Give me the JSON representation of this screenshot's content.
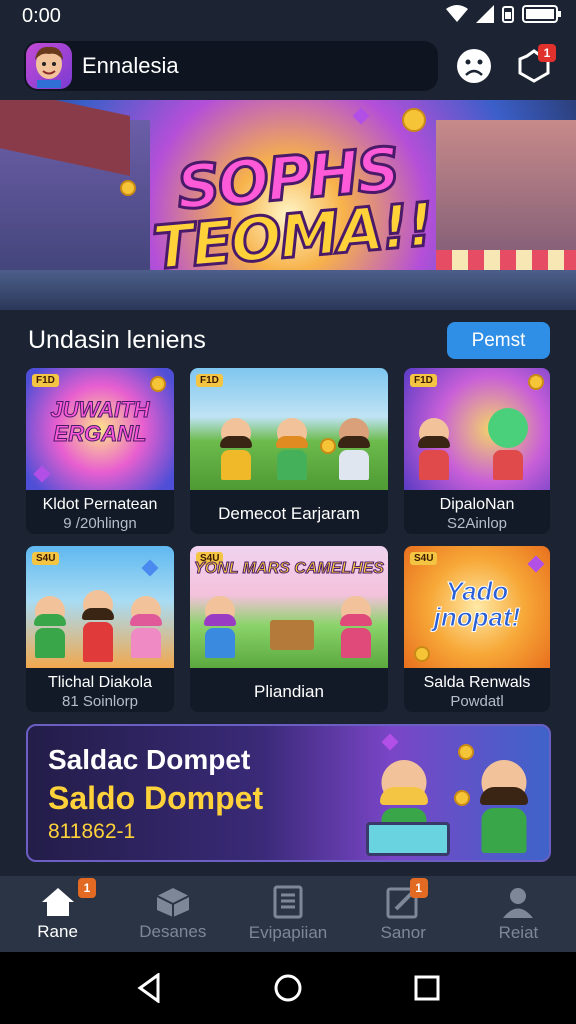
{
  "status_bar": {
    "time": "0:00"
  },
  "header": {
    "username": "Ennalesia",
    "notification_count": "1"
  },
  "hero": {
    "title_line1": "SOPHS",
    "title_line2": "TEOMA!!"
  },
  "section": {
    "title": "Undasin leniens",
    "button_label": "Pemst"
  },
  "cards": [
    {
      "tag": "F1D",
      "thumb_text": "JUWAITH ERGANL",
      "title": "Kldot Pernatean",
      "subtitle": "9 /20hlingn"
    },
    {
      "tag": "F1D",
      "thumb_text": "",
      "title": "Demecot Earjaram",
      "subtitle": ""
    },
    {
      "tag": "F1D",
      "thumb_text": "",
      "title": "DipaloNan",
      "subtitle": "S2Ainlop"
    },
    {
      "tag": "S4U",
      "thumb_text": "",
      "title": "Tlichal Diakola",
      "subtitle": "81 Soinlorp"
    },
    {
      "tag": "S4U",
      "thumb_text": "YONL MARS CAMELHES",
      "title": "Pliandian",
      "subtitle": ""
    },
    {
      "tag": "S4U",
      "thumb_text": "Yado jnopat!",
      "title": "Salda Renwals",
      "subtitle": "Powdatl"
    }
  ],
  "wallet": {
    "heading": "Saldac Dompet",
    "title": "Saldo Dompet",
    "amount": "811862-1"
  },
  "bottom_nav": [
    {
      "label": "Rane",
      "badge": "1",
      "active": true
    },
    {
      "label": "Desanes",
      "badge": "",
      "active": false
    },
    {
      "label": "Evipapiian",
      "badge": "",
      "active": false
    },
    {
      "label": "Sanor",
      "badge": "1",
      "active": false
    },
    {
      "label": "Reiat",
      "badge": "",
      "active": false
    }
  ],
  "colors": {
    "accent": "#2f8ee6",
    "badge": "#e0312c",
    "gold": "#ffd23a",
    "background": "#1c2433"
  },
  "icons": [
    "wifi-icon",
    "signal-icon",
    "battery-icon",
    "sad-face-icon",
    "settings-icon",
    "home-icon",
    "cube-icon",
    "document-icon",
    "edit-icon",
    "person-icon",
    "back-icon",
    "home-circle-icon",
    "recents-icon"
  ]
}
